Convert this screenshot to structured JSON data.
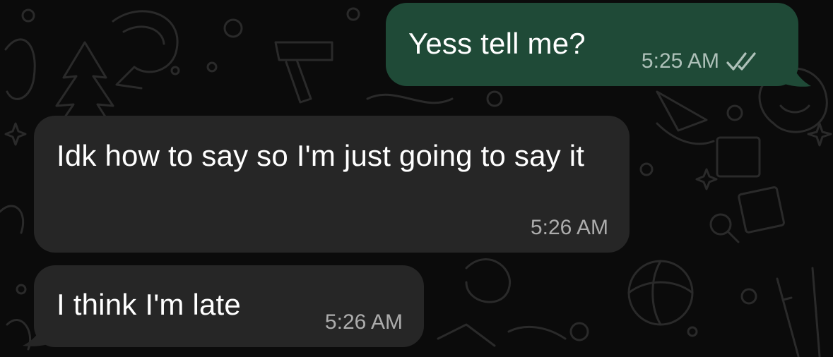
{
  "colors": {
    "background": "#0b0b0b",
    "outgoing_bubble": "#1f4a37",
    "incoming_bubble": "#262626",
    "text": "#ffffff"
  },
  "messages": [
    {
      "direction": "outgoing",
      "text": "Yess tell me?",
      "time": "5:25 AM",
      "status_icon": "double-check-icon"
    },
    {
      "direction": "incoming",
      "text": "Idk how to say so I'm just going to say it",
      "time": "5:26 AM"
    },
    {
      "direction": "incoming",
      "text": "I think I'm late",
      "time": "5:26 AM"
    }
  ]
}
